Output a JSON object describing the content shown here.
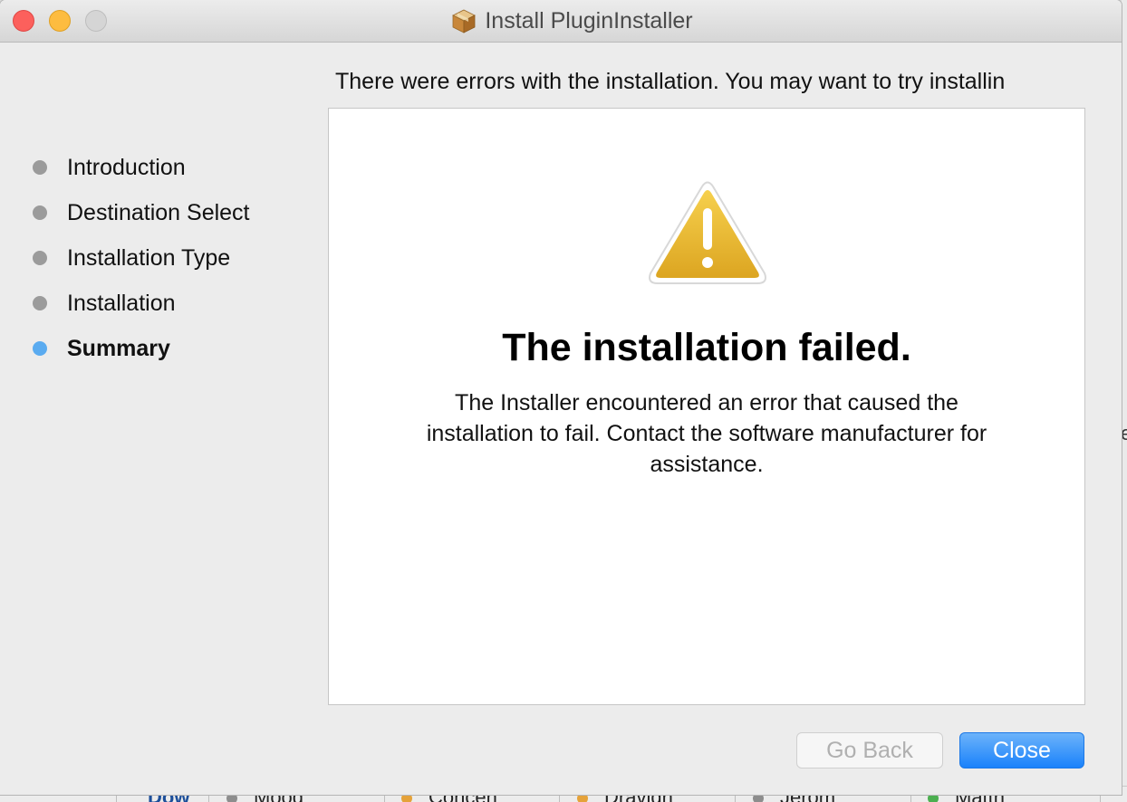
{
  "window": {
    "title": "Install PluginInstaller"
  },
  "steps": [
    {
      "label": "Introduction",
      "active": false
    },
    {
      "label": "Destination Select",
      "active": false
    },
    {
      "label": "Installation Type",
      "active": false
    },
    {
      "label": "Installation",
      "active": false
    },
    {
      "label": "Summary",
      "active": true
    }
  ],
  "header": {
    "message": "There were errors with the installation. You may want to try installin"
  },
  "result": {
    "title": "The installation failed.",
    "body": "The Installer encountered an error that caused the installation to fail. Contact the software manufacturer for assistance."
  },
  "buttons": {
    "go_back": "Go Back",
    "close": "Close"
  },
  "background_app": {
    "cells": [
      "Dow",
      "Mood",
      "Conceh",
      "Dravidn",
      "Jerom",
      "Matth"
    ],
    "right_fragment": "e"
  },
  "colors": {
    "active_step_dot": "#5aabf0",
    "inactive_step_dot": "#9b9b9b",
    "primary_button": "#1a82fb",
    "warning_fill": "#e8b228"
  }
}
